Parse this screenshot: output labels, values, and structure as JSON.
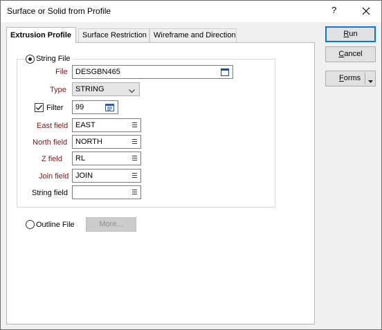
{
  "window": {
    "title": "Surface or Solid from Profile",
    "help_glyph": "?"
  },
  "tabs": [
    {
      "label": "Extrusion Profile",
      "active": true
    },
    {
      "label": "Surface Restriction",
      "active": false
    },
    {
      "label": "Wireframe and Direction",
      "active": false
    }
  ],
  "string_file": {
    "option_label": "String File",
    "selected": true,
    "file": {
      "label": "File",
      "value": "DESGBN465"
    },
    "type": {
      "label": "Type",
      "value": "STRING"
    },
    "filter": {
      "label": "Filter",
      "checked": true,
      "value": "99"
    },
    "east": {
      "label": "East field",
      "value": "EAST"
    },
    "north": {
      "label": "North field",
      "value": "NORTH"
    },
    "z": {
      "label": "Z field",
      "value": "RL"
    },
    "join": {
      "label": "Join field",
      "value": "JOIN"
    },
    "string": {
      "label": "String field",
      "value": ""
    }
  },
  "outline_file": {
    "option_label": "Outline File",
    "selected": false,
    "more_label": "More..."
  },
  "buttons": {
    "run": {
      "first": "R",
      "rest": "un"
    },
    "cancel": {
      "first": "C",
      "rest": "ancel"
    },
    "forms": {
      "first": "F",
      "rest": "orms"
    }
  },
  "colors": {
    "required_label": "#7a1a1a",
    "primary_border": "#0078d7"
  }
}
